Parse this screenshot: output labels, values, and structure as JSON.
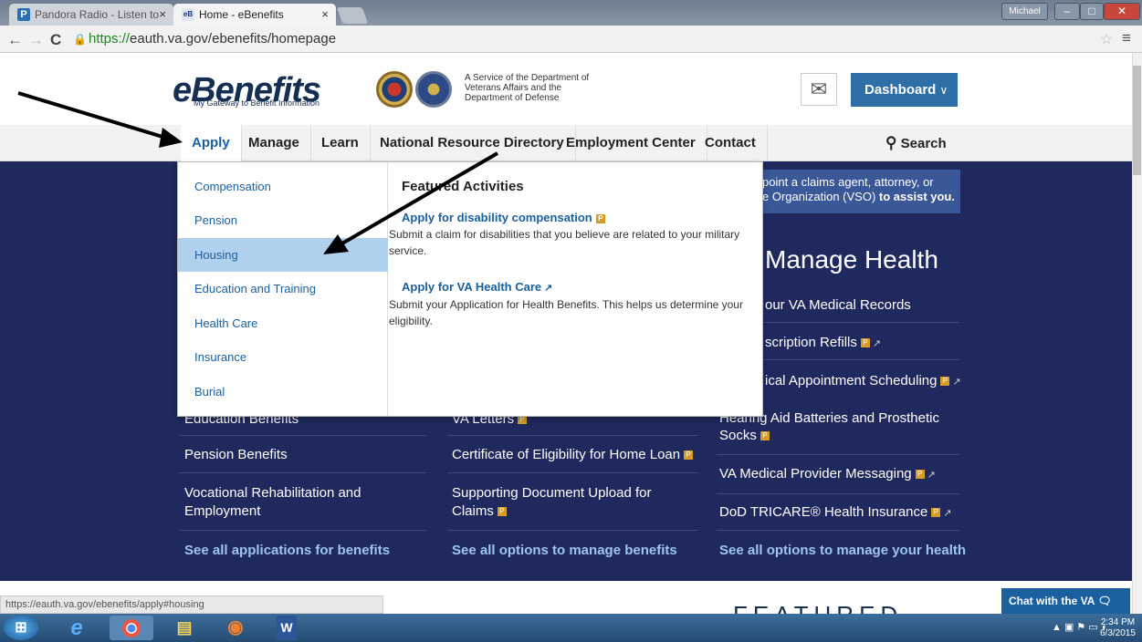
{
  "browser": {
    "tabs": [
      {
        "icon": "P",
        "title": "Pandora Radio - Listen to"
      },
      {
        "icon": "eB",
        "title": "Home - eBenefits"
      }
    ],
    "user": "Michael",
    "url_scheme": "https://",
    "url_rest": "eauth.va.gov/ebenefits/homepage",
    "status_url": "https://eauth.va.gov/ebenefits/apply#housing"
  },
  "header": {
    "logo": "eBenefits",
    "tagline": "My Gateway to Benefit Information",
    "service": "A Service of the Department of Veterans Affairs and the Department of Defense",
    "dashboard": "Dashboard"
  },
  "nav": [
    "Apply",
    "Manage",
    "Learn",
    "National Resource Directory",
    "Employment Center",
    "Contact"
  ],
  "search": "Search",
  "dropdown": {
    "items": [
      "Compensation",
      "Pension",
      "Housing",
      "Education and Training",
      "Health Care",
      "Insurance",
      "Burial"
    ],
    "featured_title": "Featured Activities",
    "activities": [
      {
        "title": "Apply for disability compensation",
        "desc": "Submit a claim for disabilities that you believe are related to your military service."
      },
      {
        "title": "Apply for VA Health Care",
        "desc": "Submit your Application for Health Benefits. This helps us determine your eligibility."
      }
    ]
  },
  "main": {
    "claim_line1": "point a claims agent, attorney, or",
    "claim_line2": "e Organization (VSO)",
    "claim_bold": "to assist you.",
    "health_title": "Manage Health",
    "health_links": [
      "our VA Medical Records",
      "scription Refills",
      "ical Appointment Scheduling",
      "Aid Batteries and Prosthetic Socks",
      "VA Medical Provider Messaging",
      "DoD TRICARE® Health Insurance"
    ],
    "hearing_prefix": "Hearing",
    "col1": [
      "Education Benefits",
      "Pension Benefits",
      "Vocational Rehabilitation and Employment"
    ],
    "col2": [
      "VA Letters",
      "Certificate of Eligibility for Home Loan",
      "Supporting Document Upload for Claims"
    ],
    "see1": "See all applications for benefits",
    "see2": "See all options to manage benefits",
    "see3": "See all options to manage your health"
  },
  "featured": "FEATURED",
  "chat": "Chat with the VA",
  "taskbar": {
    "time": "2:34 PM",
    "date": "6/3/2015"
  }
}
